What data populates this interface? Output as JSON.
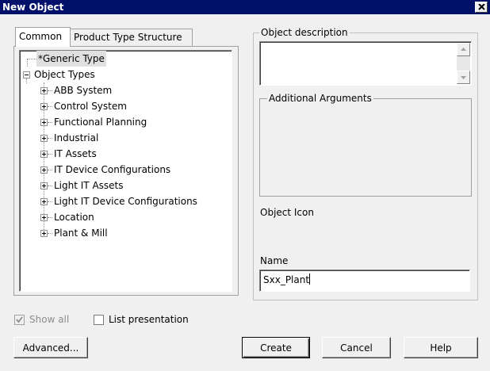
{
  "window": {
    "title": "New Object"
  },
  "tabs": [
    {
      "label": "Common"
    },
    {
      "label": "Product Type Structure"
    }
  ],
  "tree": {
    "generic": "*Generic Type",
    "root": "Object Types",
    "children": [
      "ABB System",
      "Control System",
      "Functional Planning",
      "Industrial",
      "IT Assets",
      "IT Device Configurations",
      "Light IT Assets",
      "Light IT Device Configurations",
      "Location",
      "Plant & Mill"
    ]
  },
  "right": {
    "description_label": "Object description",
    "args_label": "Additional Arguments",
    "icon_label": "Object Icon",
    "name_label": "Name",
    "name_value": "Sxx_Plant"
  },
  "options": {
    "show_all": "Show all",
    "list_presentation": "List presentation"
  },
  "buttons": {
    "advanced": "Advanced...",
    "create": "Create",
    "cancel": "Cancel",
    "help": "Help"
  }
}
